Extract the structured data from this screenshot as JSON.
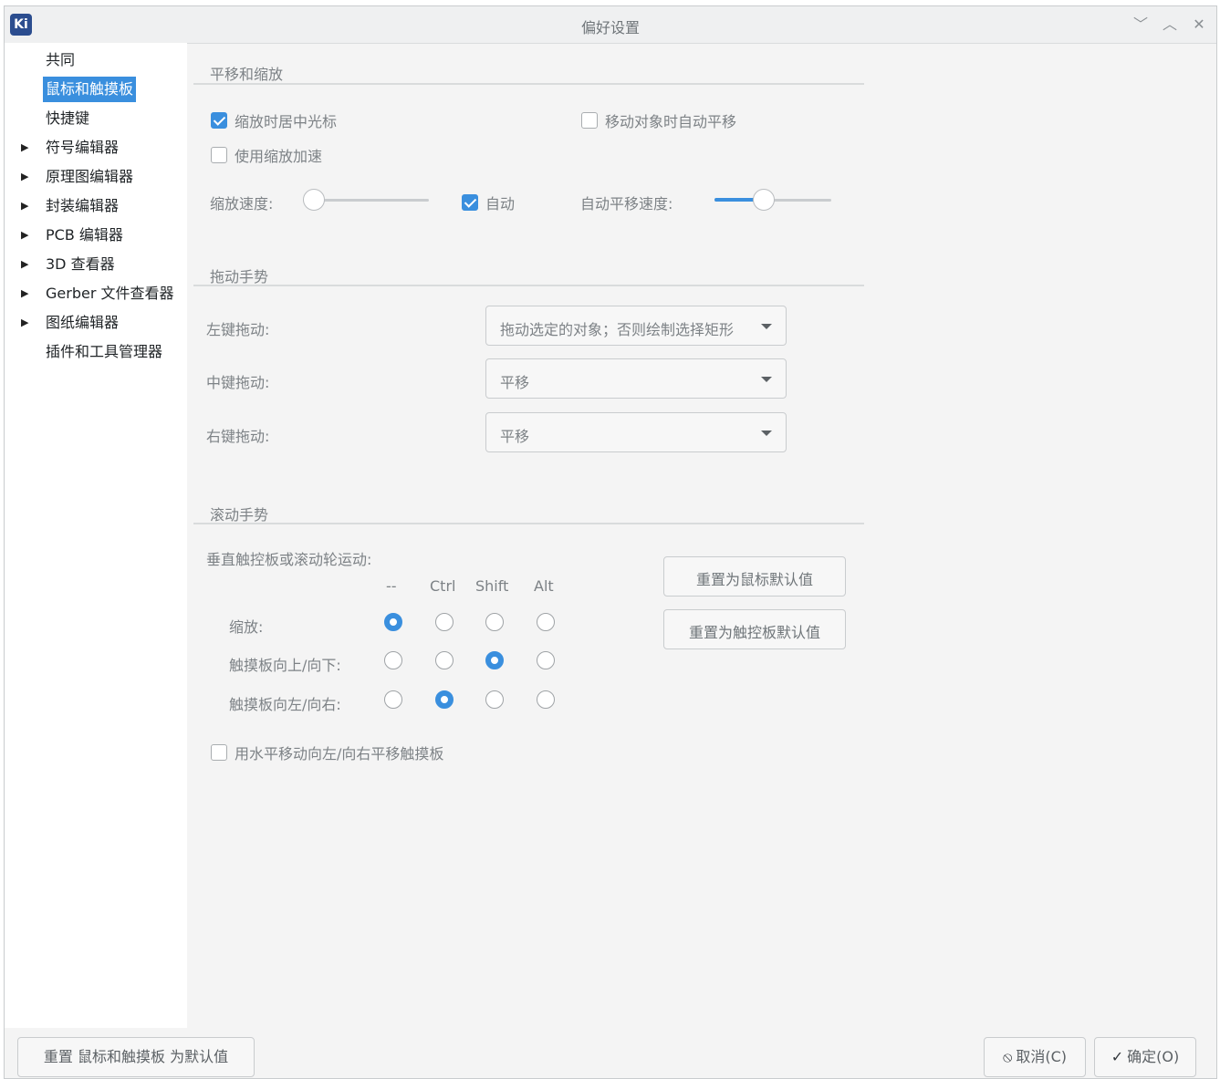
{
  "window": {
    "title": "偏好设置",
    "app_icon": "Ki",
    "controls": {
      "minimize_icon": "﹀",
      "maximize_icon": "︿",
      "close_icon": "✕"
    }
  },
  "sidebar": {
    "items": [
      {
        "label": "共同",
        "expandable": false,
        "selected": false
      },
      {
        "label": "鼠标和触摸板",
        "expandable": false,
        "selected": true
      },
      {
        "label": "快捷键",
        "expandable": false,
        "selected": false
      },
      {
        "label": "符号编辑器",
        "expandable": true,
        "selected": false
      },
      {
        "label": "原理图编辑器",
        "expandable": true,
        "selected": false
      },
      {
        "label": "封装编辑器",
        "expandable": true,
        "selected": false
      },
      {
        "label": "PCB 编辑器",
        "expandable": true,
        "selected": false
      },
      {
        "label": "3D 查看器",
        "expandable": true,
        "selected": false
      },
      {
        "label": "Gerber 文件查看器",
        "expandable": true,
        "selected": false
      },
      {
        "label": "图纸编辑器",
        "expandable": true,
        "selected": false
      },
      {
        "label": "插件和工具管理器",
        "expandable": false,
        "selected": false
      }
    ],
    "arrow_icon": "▶"
  },
  "pan_zoom": {
    "title": "平移和缩放",
    "center_cursor": {
      "label": "缩放时居中光标",
      "checked": true
    },
    "auto_pan": {
      "label": "移动对象时自动平移",
      "checked": false
    },
    "zoom_accel": {
      "label": "使用缩放加速",
      "checked": false
    },
    "zoom_speed_label": "缩放速度:",
    "zoom_speed_value": 0,
    "auto_label": "自动",
    "auto_checked": true,
    "auto_pan_speed_label": "自动平移速度:",
    "auto_pan_speed_value": 0.4
  },
  "drag": {
    "title": "拖动手势",
    "left_label": "左键拖动:",
    "left_value": "拖动选定的对象；否则绘制选择矩形",
    "middle_label": "中键拖动:",
    "middle_value": "平移",
    "right_label": "右键拖动:",
    "right_value": "平移"
  },
  "scroll": {
    "title": "滚动手势",
    "vertical_label": "垂直触控板或滚动轮运动:",
    "modifiers": [
      "--",
      "Ctrl",
      "Shift",
      "Alt"
    ],
    "rows": [
      {
        "label": "缩放:",
        "selected": 0
      },
      {
        "label": "触摸板向上/向下:",
        "selected": 2
      },
      {
        "label": "触摸板向左/向右:",
        "selected": 1
      }
    ],
    "reset_mouse": "重置为鼠标默认值",
    "reset_trackpad": "重置为触控板默认值",
    "horizontal_pan": {
      "label": "用水平移动向左/向右平移触摸板",
      "checked": false
    }
  },
  "footer": {
    "reset_defaults": "重置 鼠标和触摸板 为默认值",
    "cancel": "取消(C)",
    "cancel_icon": "⦸",
    "ok": "确定(O)",
    "ok_icon": "✓"
  },
  "colors": {
    "accent": "#3a8fde",
    "window_bg": "#f4f4f4",
    "sidebar_bg": "#ffffff"
  }
}
